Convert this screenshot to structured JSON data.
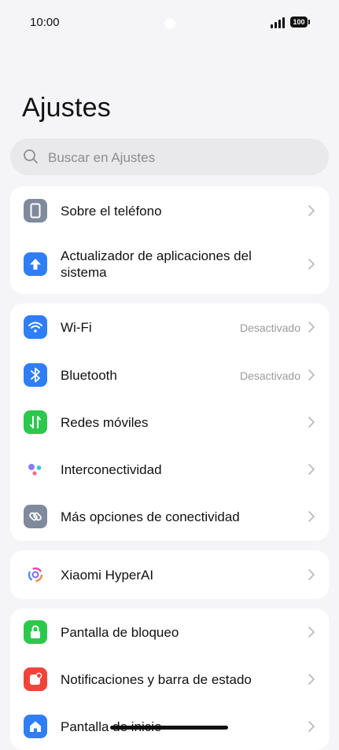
{
  "status_bar": {
    "time": "10:00",
    "battery": "100",
    "signal_icon": "signal-icon"
  },
  "page": {
    "title": "Ajustes"
  },
  "search": {
    "placeholder": "Buscar en Ajustes"
  },
  "colors": {
    "blue": "#2f7ef6",
    "green": "#2cc84d",
    "red": "#f0443b",
    "gray_icon": "#7f8a9d",
    "background": "#f5f5f7"
  },
  "groups": [
    {
      "items": [
        {
          "label": "Sobre el teléfono",
          "icon": "phone-icon"
        },
        {
          "label": "Actualizador de aplicaciones del sistema",
          "icon": "arrow-up-icon"
        }
      ]
    },
    {
      "items": [
        {
          "label": "Wi-Fi",
          "value": "Desactivado",
          "icon": "wifi-icon"
        },
        {
          "label": "Bluetooth",
          "value": "Desactivado",
          "icon": "bluetooth-icon"
        },
        {
          "label": "Redes móviles",
          "icon": "mobile-data-icon"
        },
        {
          "label": "Interconectividad",
          "icon": "interconnectivity-icon"
        },
        {
          "label": "Más opciones de conectividad",
          "icon": "link-icon"
        }
      ]
    },
    {
      "items": [
        {
          "label": "Xiaomi HyperAI",
          "icon": "hyperai-icon"
        }
      ]
    },
    {
      "items": [
        {
          "label": "Pantalla de bloqueo",
          "icon": "lock-icon"
        },
        {
          "label": "Notificaciones y barra de estado",
          "icon": "notification-icon"
        },
        {
          "label": "Pantalla de inicio",
          "icon": "home-icon"
        }
      ]
    }
  ]
}
